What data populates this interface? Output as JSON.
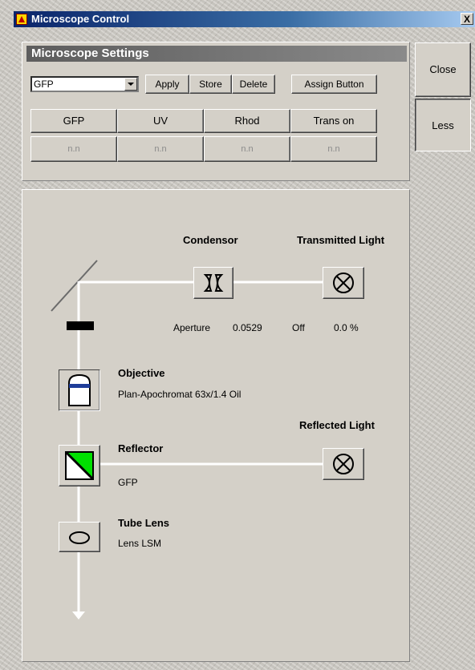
{
  "window": {
    "title": "Microscope Control",
    "close_glyph": "X"
  },
  "settings": {
    "header": "Microscope Settings",
    "preset_select": {
      "value": "GFP"
    },
    "buttons": {
      "apply": "Apply",
      "store": "Store",
      "delete": "Delete",
      "assign": "Assign Button"
    },
    "quick_buttons": [
      "GFP",
      "UV",
      "Rhod",
      "Trans on"
    ],
    "nn_buttons": [
      "n.n",
      "n.n",
      "n.n",
      "n.n"
    ]
  },
  "side": {
    "close": "Close",
    "less": "Less"
  },
  "diagram": {
    "condensor": {
      "title": "Condensor",
      "aperture_label": "Aperture",
      "aperture_value": "0.0529"
    },
    "transmitted": {
      "title": "Transmitted Light",
      "state": "Off",
      "level": "0.0 %"
    },
    "objective": {
      "title": "Objective",
      "value": "Plan-Apochromat 63x/1.4 Oil"
    },
    "reflected": {
      "title": "Reflected Light"
    },
    "reflector": {
      "title": "Reflector",
      "value": "GFP"
    },
    "tube_lens": {
      "title": "Tube Lens",
      "value": "Lens LSM"
    }
  },
  "colors": {
    "accent_green": "#00e000",
    "objective_band": "#1f3d99"
  }
}
